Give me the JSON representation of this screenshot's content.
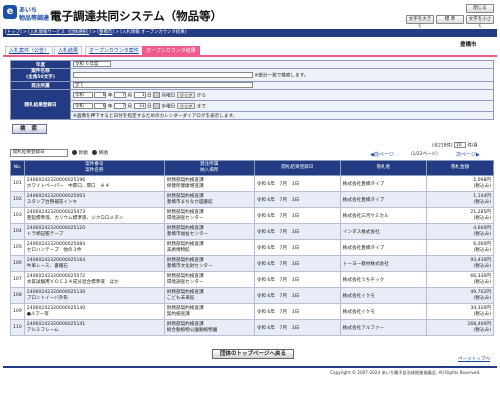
{
  "header": {
    "logo_text1": "あいち",
    "logo_text2": "物品等調達",
    "title": "電子調達共同システム（物品等）",
    "buttons": [
      "文字を大きく",
      "標 準",
      "文字を小さく"
    ],
    "close_label": "閉じる"
  },
  "breadcrumb": [
    "トップ",
    "入札情報サービス（団体選択）",
    "豊橋市",
    "入札情報 オープンカウンタ結果"
  ],
  "org": "豊橋市",
  "tabs": [
    "入札案件（公告）",
    "入札結果",
    "オープンカウンタ案件",
    "オープンカウンタ結果"
  ],
  "form": {
    "fiscal_year_label": "年度",
    "fiscal_year_value": "令和 ６年度",
    "case_name_label": "案件名称",
    "case_name_sub": "(全角50文字)",
    "case_name_note": "※部分一致で検索します。",
    "division_label": "発注所属",
    "division_value": "全て",
    "date_label": "開札結果登録日",
    "from": {
      "era": "令和",
      "y": "6",
      "m": "7",
      "d": "1",
      "dow": "月曜日",
      "clear": "クリア",
      "suffix": "から"
    },
    "to": {
      "era": "令和",
      "y": "6",
      "m": "7",
      "d": "31",
      "dow": "水曜日",
      "clear": "クリア",
      "suffix": "まで"
    },
    "calendar_note": "※画像を押下すると日付を指定するためのカレンダーダイアログを表示します。",
    "search_button": "検 索"
  },
  "toolbar": {
    "sort_value": "開札結果登録日",
    "asc_label": "昇順",
    "desc_label": "降順",
    "count_text": "(全218件)",
    "per_page": "10",
    "per_page_suffix": "件/頁",
    "prev": "前ページ",
    "page_info": "（1/22ページ）",
    "next": "次ページ"
  },
  "table": {
    "headers": {
      "no": "No.",
      "case": [
        "案件番号",
        "案件名称"
      ],
      "division": [
        "発注所属",
        "納入場所"
      ],
      "date": "開札結果登録日",
      "winner": "落札者",
      "amount": "落札金額"
    },
    "rows": [
      {
        "no": "101",
        "id": "24060242320000025196",
        "name": "ホワイトペーパー　中厚口、厚口　Ａ４",
        "div1": "財務部契約検査課",
        "div2": "保健所健康増進課",
        "date": "令和 6年　7月　3日",
        "winner": "株式会社豊橋タイプ",
        "amount": "2,098円",
        "tax": "(税込み)"
      },
      {
        "no": "102",
        "id": "24060242320000025003",
        "name": "スタンプ台用補充インキ",
        "div1": "財務部契約検査課",
        "div2": "豊橋市まちなか図書館",
        "date": "令和 6年　7月　3日",
        "winner": "株式会社豊橋タイプ",
        "amount": "1,144円",
        "tax": "(税込み)"
      },
      {
        "no": "103",
        "id": "24060242320000025073",
        "name": "亜鉛標準液、カリウム標準液、ジクロロメタン",
        "div1": "財務部契約検査課",
        "div2": "環境調査センター",
        "date": "令和 6年　7月　3日",
        "winner": "株式会社三河ケミカル",
        "amount": "21,285円",
        "tax": "(税込み)"
      },
      {
        "no": "104",
        "id": "24060242320000025120",
        "name": "トラ柄記帳テープ",
        "div1": "財務部契約検査課",
        "div2": "豊橋市福祉センター",
        "date": "令和 6年　7月　3日",
        "winner": "インタス株式会社",
        "amount": "4,600円",
        "tax": "(税込み)"
      },
      {
        "no": "105",
        "id": "24060242320000025084",
        "name": "セロハンテープ　他の３件",
        "div1": "財務部契約検査課",
        "div2": "美術博物館",
        "date": "令和 6年　7月　3日",
        "winner": "株式会社豊橋タイプ",
        "amount": "6,000円",
        "tax": "(税込み)"
      },
      {
        "no": "106",
        "id": "24060242320000025164",
        "name": "牛革レース、書籍石",
        "div1": "財務部契約検査課",
        "div2": "豊橋市文化財センター",
        "date": "令和 6年　7月　3日",
        "winner": "トーヨー教材株式会社",
        "amount": "93,430円",
        "tax": "(税込み)"
      },
      {
        "no": "107",
        "id": "24060242320000025072",
        "name": "水質試験用ＶＯＣ２４成分混合標準液　ほか",
        "div1": "財務部契約検査課",
        "div2": "環境調査センター",
        "date": "令和 6年　7月　3日",
        "winner": "株式会社うちチック",
        "amount": "66,330円",
        "tax": "(税込み)"
      },
      {
        "no": "108",
        "id": "24060242320000025130",
        "name": "プロントイーバ外形",
        "div1": "財務部契約検査課",
        "div2": "こども未来館",
        "date": "令和 6年　7月　3日",
        "winner": "株式会社イクモ",
        "amount": "49,702円",
        "tax": "(税込み)"
      },
      {
        "no": "109",
        "id": "24060242320000025140",
        "name": "●ルアー等",
        "div1": "財務部契約検査課",
        "div2": "契約検査課",
        "date": "令和 6年　7月　3日",
        "winner": "株式会社イクモ",
        "amount": "34,320円",
        "tax": "(税込み)"
      },
      {
        "no": "110",
        "id": "24060242320000025141",
        "name": "アルミフレーム",
        "div1": "財務部契約検査課",
        "div2": "総合動植物公園動植物園",
        "date": "令和 6年　7月　3日",
        "winner": "株式会社アルファー",
        "amount": "268,400円",
        "tax": "(税込み)"
      }
    ]
  },
  "top_button": "団体のトップページへ戻る",
  "page_top": "ページトップへ",
  "copyright": "Copyright © 2007-2024 あいち電子自治体推進協議会, All Rights Reserved."
}
